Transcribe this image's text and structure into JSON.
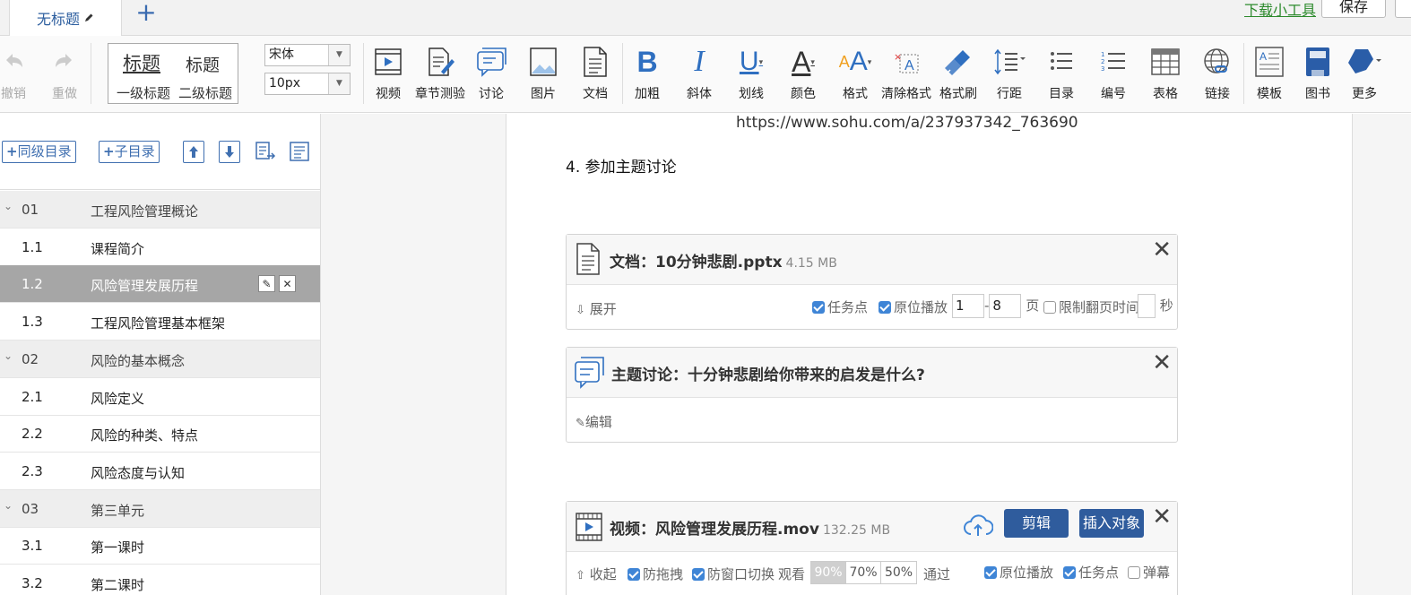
{
  "tabs": {
    "title": "无标题",
    "add": "+"
  },
  "top_links": {
    "download": "下载小工具",
    "save": "保存"
  },
  "toolbar": {
    "undo": "撤销",
    "redo": "重做",
    "heading1_big": "标题",
    "heading2_big": "标题",
    "heading1_label": "一级标题",
    "heading2_label": "二级标题",
    "font_family": "宋体",
    "font_size": "10px",
    "video": "视频",
    "quiz": "章节测验",
    "discussion": "讨论",
    "image": "图片",
    "document": "文档",
    "bold": "加粗",
    "italic": "斜体",
    "underline": "划线",
    "color": "颜色",
    "format": "格式",
    "clear_format": "清除格式",
    "format_painter": "格式刷",
    "line_spacing": "行距",
    "toc": "目录",
    "numbering": "编号",
    "table": "表格",
    "link": "链接",
    "template": "模板",
    "book": "图书",
    "more": "更多"
  },
  "sidebar": {
    "add_sibling": "同级目录",
    "add_child": "子目录",
    "rows": [
      {
        "num": "01",
        "title": "工程风险管理概论",
        "type": "chapter"
      },
      {
        "num": "1.1",
        "title": "课程简介",
        "type": "section"
      },
      {
        "num": "1.2",
        "title": "风险管理发展历程",
        "type": "active"
      },
      {
        "num": "1.3",
        "title": "工程风险管理基本框架",
        "type": "section"
      },
      {
        "num": "02",
        "title": "风险的基本概念",
        "type": "chapter"
      },
      {
        "num": "2.1",
        "title": "风险定义",
        "type": "section"
      },
      {
        "num": "2.2",
        "title": "风险的种类、特点",
        "type": "section"
      },
      {
        "num": "2.3",
        "title": "风险态度与认知",
        "type": "section"
      },
      {
        "num": "03",
        "title": "第三单元",
        "type": "chapter"
      },
      {
        "num": "3.1",
        "title": "第一课时",
        "type": "section"
      },
      {
        "num": "3.2",
        "title": "第二课时",
        "type": "section"
      }
    ]
  },
  "editor": {
    "url_text": "https://www.sohu.com/a/237937342_763690",
    "paragraph": "4. 参加主题讨论",
    "doc_card": {
      "title": "文档：10分钟悲剧.pptx",
      "size": "4.15 MB",
      "expand": "展开",
      "task_point": "任务点",
      "inplace_play": "原位播放",
      "page_from": "1",
      "dash": "-",
      "page_to": "8",
      "page_unit": "页",
      "limit_time": "限制翻页时间",
      "seconds": "秒"
    },
    "topic_card": {
      "title": "主题讨论：十分钟悲剧给你带来的启发是什么?",
      "edit": "编辑"
    },
    "video_card": {
      "title": "视频：风险管理发展历程.mov",
      "size": "132.25 MB",
      "clip": "剪辑",
      "insert": "插入对象",
      "collapse": "收起",
      "anti_drag": "防拖拽",
      "anti_switch": "防窗口切换",
      "watch": "观看",
      "pct": [
        "90%",
        "70%",
        "50%"
      ],
      "pass": "通过",
      "inplace_play": "原位播放",
      "task_point": "任务点",
      "danmaku": "弹幕"
    }
  }
}
